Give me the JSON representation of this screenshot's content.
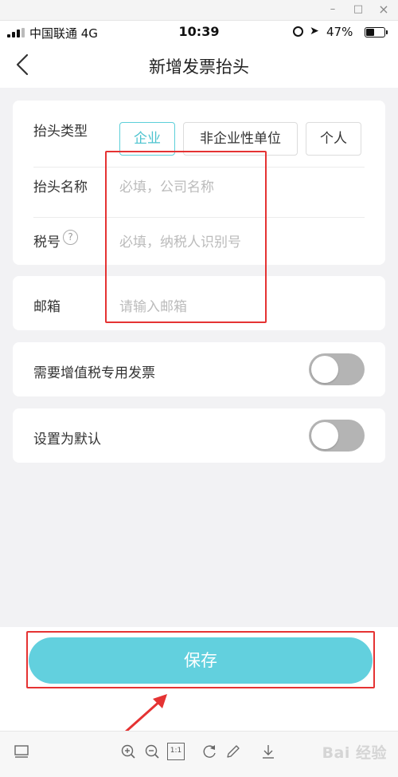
{
  "window": {
    "minimize": "–",
    "maximize": "□",
    "close": "×"
  },
  "status_bar": {
    "carrier": "中国联通 4G",
    "time": "10:39",
    "battery_percent": "47%",
    "battery_level": 0.47
  },
  "nav": {
    "title": "新增发票抬头",
    "back_icon": "chevron-left-icon"
  },
  "form": {
    "header_type": {
      "label": "抬头类型",
      "options": [
        "企业",
        "非企业性单位",
        "个人"
      ],
      "selected": "企业"
    },
    "header_name": {
      "label": "抬头名称",
      "placeholder": "必填，公司名称"
    },
    "tax_id": {
      "label": "税号",
      "placeholder": "必填，纳税人识别号",
      "help_symbol": "?"
    },
    "email": {
      "label": "邮箱",
      "placeholder": "请输入邮箱"
    },
    "vat_special": {
      "label": "需要增值税专用发票",
      "on": false
    },
    "set_default": {
      "label": "设置为默认",
      "on": false
    }
  },
  "save": {
    "label": "保存"
  },
  "toolbar": {
    "icons": [
      "panel-icon",
      "zoom-in-icon",
      "zoom-out-icon",
      "actual-size-icon",
      "rotate-icon",
      "edit-icon",
      "download-icon"
    ],
    "actual_size_label": "1:1",
    "watermark": "Bai 经验"
  },
  "colors": {
    "accent": "#62d0de",
    "annotation_red": "#e53333",
    "page_bg": "#f2f2f4"
  }
}
